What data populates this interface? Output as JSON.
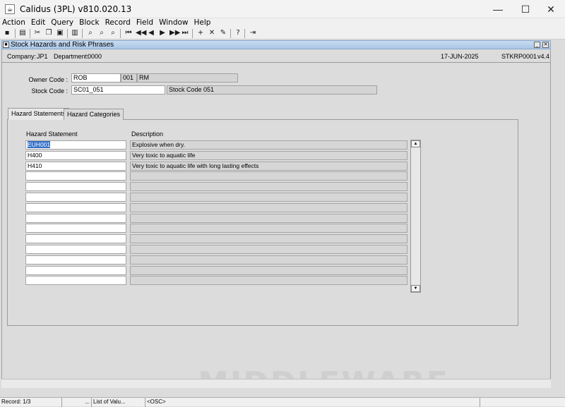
{
  "window": {
    "title": "Calidus (3PL) v810.020.13"
  },
  "menu": [
    "Action",
    "Edit",
    "Query",
    "Block",
    "Record",
    "Field",
    "Window",
    "Help"
  ],
  "form": {
    "title": "Stock Hazards and Risk Phrases",
    "company_label": "Company:",
    "company": "JP1",
    "department_label": "Department:",
    "department": "0000",
    "date": "17-JUN-2025",
    "form_id": "STKRP0001",
    "version": "v4.4"
  },
  "owner": {
    "label": "Owner Code :",
    "code": "ROB",
    "num": "001",
    "name": "RM"
  },
  "stock": {
    "label": "Stock Code :",
    "code": "SC01_051",
    "desc": "Stock Code 051"
  },
  "tabs": [
    "Hazard Statements",
    "Hazard Categories"
  ],
  "grid": {
    "col_hazard": "Hazard Statement",
    "col_desc": "Description",
    "rows": [
      {
        "code": "EUH001",
        "desc": "Explosive when dry."
      },
      {
        "code": "H400",
        "desc": "Very toxic to aquatic life"
      },
      {
        "code": "H410",
        "desc": "Very toxic to aquatic life with long lasting effects"
      },
      {
        "code": "",
        "desc": ""
      },
      {
        "code": "",
        "desc": ""
      },
      {
        "code": "",
        "desc": ""
      },
      {
        "code": "",
        "desc": ""
      },
      {
        "code": "",
        "desc": ""
      },
      {
        "code": "",
        "desc": ""
      },
      {
        "code": "",
        "desc": ""
      },
      {
        "code": "",
        "desc": ""
      },
      {
        "code": "",
        "desc": ""
      },
      {
        "code": "",
        "desc": ""
      },
      {
        "code": "",
        "desc": ""
      }
    ]
  },
  "watermark": "MIDDLEWARE",
  "status": {
    "record": "Record: 1/3",
    "dots": "...",
    "lov": "List of Valu...",
    "osc": "<OSC>"
  }
}
